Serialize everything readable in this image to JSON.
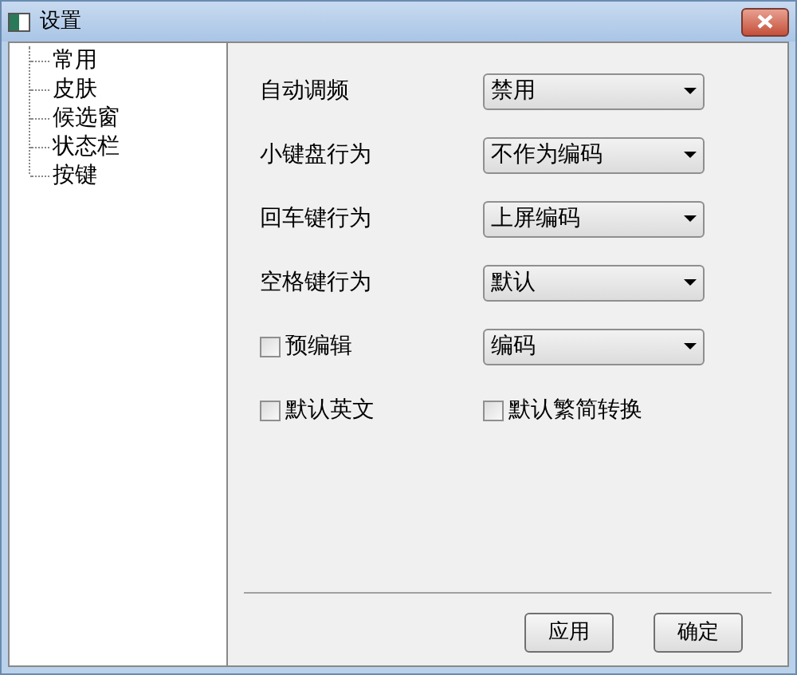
{
  "window": {
    "title": "设置"
  },
  "tree": {
    "items": [
      {
        "label": "常用",
        "selected": false
      },
      {
        "label": "皮肤",
        "selected": false
      },
      {
        "label": "候选窗",
        "selected": false
      },
      {
        "label": "状态栏",
        "selected": false
      },
      {
        "label": "按键",
        "selected": false
      }
    ]
  },
  "settings": [
    {
      "kind": "select",
      "label": "自动调频",
      "value": "禁用"
    },
    {
      "kind": "select",
      "label": "小键盘行为",
      "value": "不作为编码"
    },
    {
      "kind": "select",
      "label": "回车键行为",
      "value": "上屏编码"
    },
    {
      "kind": "select",
      "label": "空格键行为",
      "value": "默认"
    },
    {
      "kind": "checkselect",
      "label": "预编辑",
      "checked": false,
      "value": "编码"
    },
    {
      "kind": "checks",
      "items": [
        {
          "label": "默认英文",
          "checked": false
        },
        {
          "label": "默认繁简转换",
          "checked": false
        }
      ]
    }
  ],
  "buttons": [
    "应用",
    "确定"
  ]
}
